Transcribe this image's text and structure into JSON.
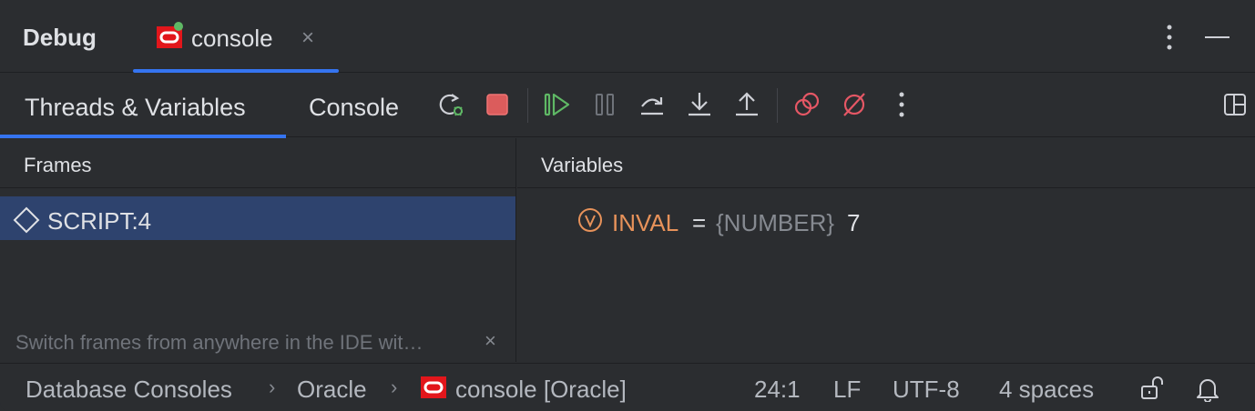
{
  "header": {
    "title": "Debug",
    "session_tab": {
      "label": "console",
      "close": "×"
    }
  },
  "debug_tabs": [
    {
      "label": "Threads & Variables",
      "active": true
    },
    {
      "label": "Console",
      "active": false
    }
  ],
  "toolbar_icons": [
    "rerun-debug-icon",
    "stop-icon",
    "resume-icon",
    "pause-icon",
    "step-over-icon",
    "step-into-icon",
    "step-out-icon",
    "view-breakpoints-icon",
    "mute-breakpoints-icon",
    "more-icon",
    "layout-icon"
  ],
  "frames": {
    "header": "Frames",
    "items": [
      {
        "label": "SCRIPT:4",
        "selected": true
      }
    ],
    "hint": "Switch frames from anywhere in the IDE wit…",
    "hint_close": "×"
  },
  "variables": {
    "header": "Variables",
    "items": [
      {
        "name": "INVAL",
        "eq": "=",
        "type": "{NUMBER}",
        "value": "7"
      }
    ]
  },
  "status_bar": {
    "breadcrumbs": [
      "Database Consoles",
      "Oracle",
      "console [Oracle]"
    ],
    "separator": "›",
    "position": "24:1",
    "line_ending": "LF",
    "encoding": "UTF-8",
    "indent": "4 spaces"
  },
  "colors": {
    "accent": "#3574f0",
    "selection": "#2e436e",
    "variable_name": "#e7925a",
    "oracle_red": "#e2161b",
    "green": "#5fb865"
  }
}
